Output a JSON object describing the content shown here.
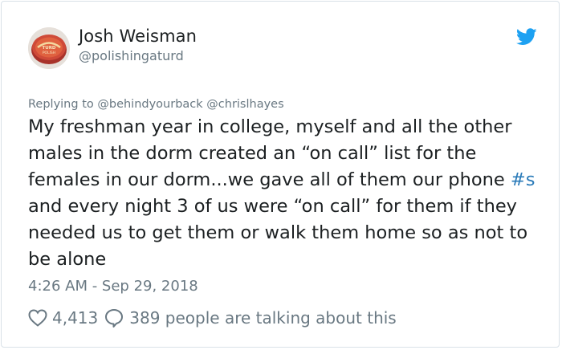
{
  "author": {
    "name": "Josh Weisman",
    "handle": "@polishingaturd",
    "avatar_icon": "tin-can-logo"
  },
  "reply": {
    "prefix": "Replying to",
    "mentions": [
      "@behindyourback",
      "@chrislhayes"
    ]
  },
  "tweet": {
    "text_part1": "My freshman year in college, myself and all the other males in the dorm created an “on call” list for the females in our dorm...we gave all of them our phone ",
    "hashtag": "#s",
    "text_part2": " and every night 3 of us were “on call” for them if they needed us to get them or walk them home so as not to be alone"
  },
  "timestamp": "4:26 AM - Sep 29, 2018",
  "actions": {
    "likes": "4,413",
    "replies_text": "389 people are talking about this",
    "like_icon": "heart-icon",
    "reply_icon": "speech-bubble-icon"
  },
  "colors": {
    "text": "#1c2022",
    "muted": "#697882",
    "link": "#2b7bb9",
    "twitter_blue": "#1da1f2"
  }
}
